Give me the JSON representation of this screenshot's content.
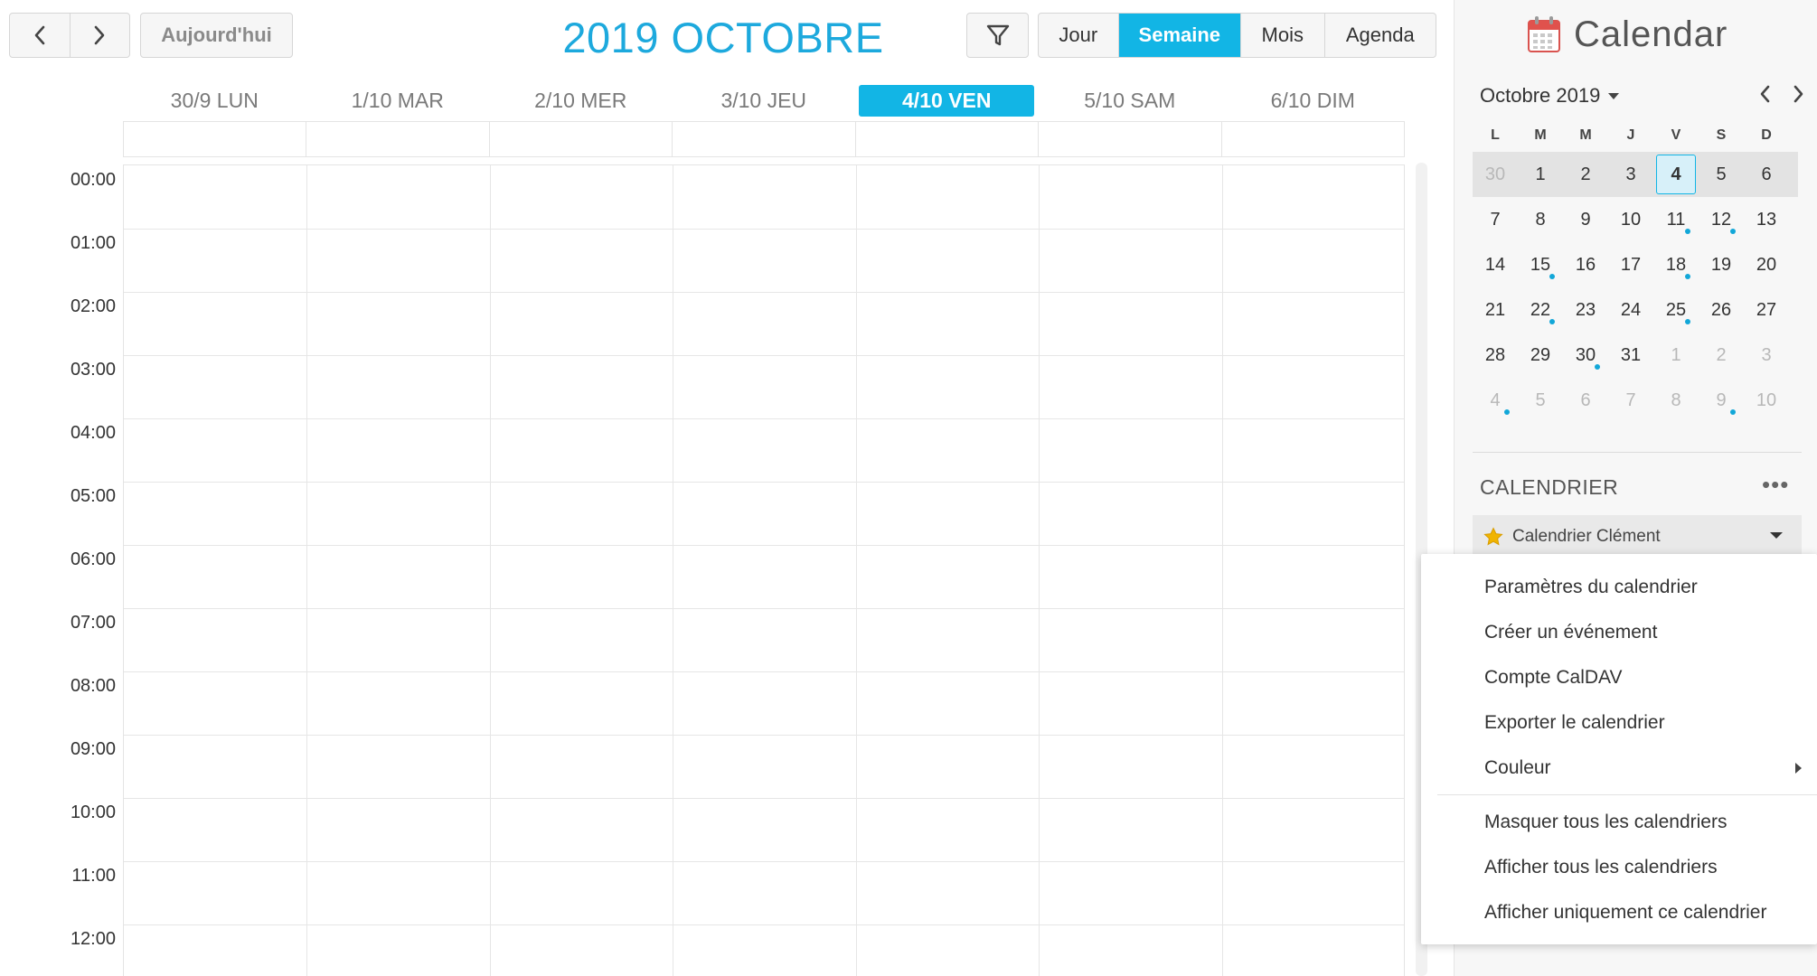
{
  "toolbar": {
    "prev_label": "previous",
    "next_label": "next",
    "today_label": "Aujourd'hui",
    "title": "2019 OCTOBRE",
    "views": [
      "Jour",
      "Semaine",
      "Mois",
      "Agenda"
    ],
    "active_view": "Semaine"
  },
  "week": {
    "days": [
      "30/9 LUN",
      "1/10 MAR",
      "2/10 MER",
      "3/10 JEU",
      "4/10 VEN",
      "5/10 SAM",
      "6/10 DIM"
    ],
    "today_index": 4,
    "hours": [
      "00:00",
      "01:00",
      "02:00",
      "03:00",
      "04:00",
      "05:00",
      "06:00",
      "07:00",
      "08:00",
      "09:00",
      "10:00",
      "11:00",
      "12:00"
    ]
  },
  "sidebar": {
    "app_title": "Calendar",
    "mini_month": "Octobre 2019",
    "weekdays": [
      "L",
      "M",
      "M",
      "J",
      "V",
      "S",
      "D"
    ],
    "weeks": [
      [
        "30",
        "1",
        "2",
        "3",
        "4",
        "5",
        "6"
      ],
      [
        "7",
        "8",
        "9",
        "10",
        "11",
        "12",
        "13"
      ],
      [
        "14",
        "15",
        "16",
        "17",
        "18",
        "19",
        "20"
      ],
      [
        "21",
        "22",
        "23",
        "24",
        "25",
        "26",
        "27"
      ],
      [
        "28",
        "29",
        "30",
        "31",
        "1",
        "2",
        "3"
      ],
      [
        "4",
        "5",
        "6",
        "7",
        "8",
        "9",
        "10"
      ]
    ],
    "section_title": "CALENDRIER",
    "more_label": "•••",
    "calendar_name": "Calendrier Clément"
  },
  "context_menu": {
    "items": [
      "Paramètres du calendrier",
      "Créer un événement",
      "Compte CalDAV",
      "Exporter le calendrier",
      "Couleur",
      "Masquer tous les calendriers",
      "Afficher tous les calendriers",
      "Afficher uniquement ce calendrier"
    ]
  },
  "colors": {
    "accent": "#12b5e5",
    "title": "#1da9dd",
    "event_dot": "#12a7d8",
    "star": "#f0b400"
  }
}
